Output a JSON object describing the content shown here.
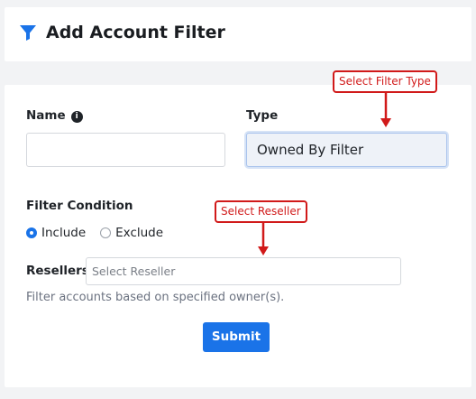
{
  "header": {
    "title": "Add Account Filter",
    "icon": "filter-icon",
    "icon_color": "#1a73e8"
  },
  "form": {
    "name_label": "Name",
    "name_value": "",
    "type_label": "Type",
    "type_value": "Owned By Filter",
    "filter_condition_label": "Filter Condition",
    "radio_options": [
      {
        "label": "Include",
        "checked": true
      },
      {
        "label": "Exclude",
        "checked": false
      }
    ],
    "resellers_label": "Resellers",
    "resellers_placeholder": "Select Reseller",
    "help_text": "Filter accounts based on specified owner(s).",
    "submit_label": "Submit"
  },
  "annotations": {
    "filter_type": "Select Filter Type",
    "reseller": "Select Reseller",
    "color": "#d11a1a"
  },
  "colors": {
    "accent": "#1a73e8"
  }
}
